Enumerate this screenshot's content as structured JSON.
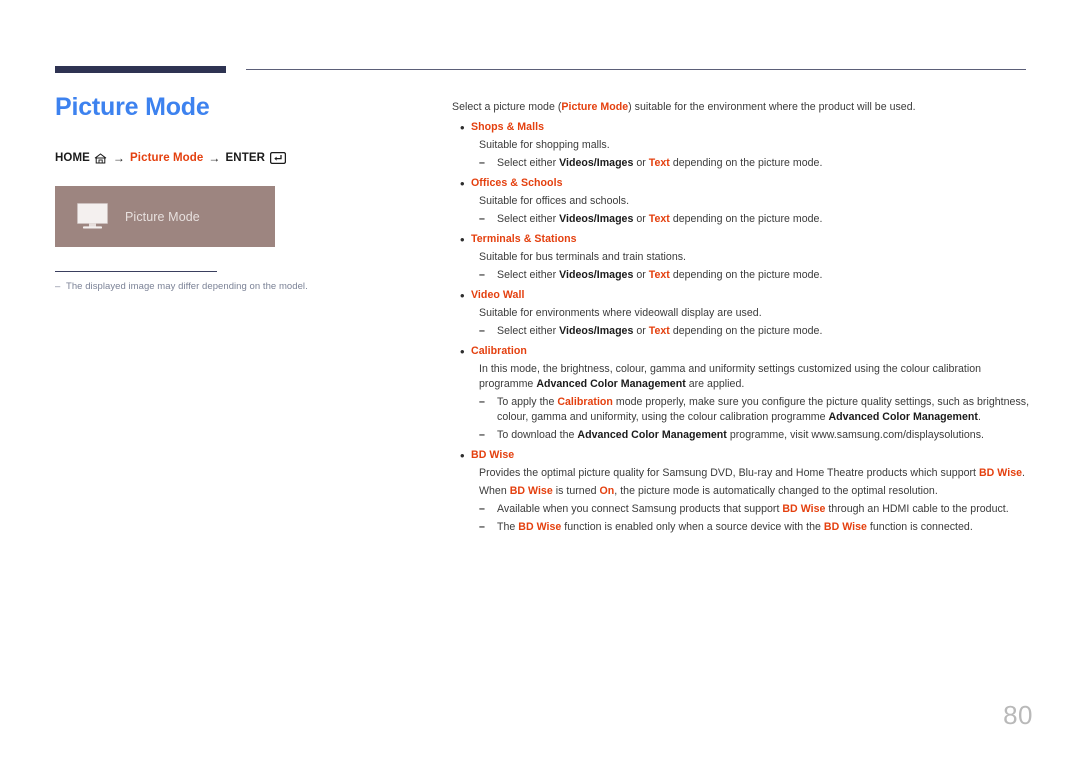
{
  "page": {
    "title": "Picture Mode",
    "number": "80"
  },
  "breadcrumb": {
    "home_label": "HOME",
    "home_icon": "home-icon",
    "arrow": "→",
    "middle_label": "Picture Mode",
    "enter_label": "ENTER",
    "enter_icon": "enter-key-icon"
  },
  "preview": {
    "icon": "monitor-icon",
    "label": "Picture Mode"
  },
  "note": {
    "dash": "–",
    "text": "The displayed image may differ depending on the model."
  },
  "content": {
    "intro": {
      "pre": "Select a picture mode (",
      "bold": "Picture Mode",
      "post": ") suitable for the environment where the product will be used."
    },
    "bullet_char": "•",
    "dash_char": "–",
    "common_dash": {
      "pre": "Select either ",
      "b1": "Videos/Images",
      "mid": " or ",
      "b2": "Text",
      "post": " depending on the picture mode."
    },
    "items": [
      {
        "title": "Shops & Malls",
        "desc": "Suitable for shopping malls."
      },
      {
        "title": "Offices & Schools",
        "desc": "Suitable for offices and schools."
      },
      {
        "title": "Terminals & Stations",
        "desc": "Suitable for bus terminals and train stations."
      },
      {
        "title": "Video Wall",
        "desc": "Suitable for environments where videowall display are used."
      }
    ],
    "calibration": {
      "title": "Calibration",
      "desc_pre": "In this mode, the brightness, colour, gamma and uniformity settings customized using the colour calibration programme ",
      "desc_bold": "Advanced Color Management",
      "desc_post": " are applied.",
      "dash1_pre": "To apply the ",
      "dash1_red": "Calibration",
      "dash1_mid": " mode properly, make sure you configure the picture quality settings, such as brightness, colour, gamma and uniformity, using the colour calibration programme ",
      "dash1_bold": "Advanced Color Management",
      "dash1_post": ".",
      "dash2_pre": "To download the ",
      "dash2_bold": "Advanced Color Management",
      "dash2_post": " programme, visit www.samsung.com/displaysolutions."
    },
    "bdwise": {
      "title": "BD Wise",
      "p1_pre": "Provides the optimal picture quality for Samsung DVD, Blu-ray and Home Theatre products which support ",
      "p1_red": "BD Wise",
      "p1_post": ".",
      "p2_pre": "When ",
      "p2_red1": "BD Wise",
      "p2_mid1": " is turned ",
      "p2_red2": "On",
      "p2_post": ", the picture mode is automatically changed to the optimal resolution.",
      "dash1_pre": "Available when you connect Samsung products that support ",
      "dash1_red": "BD Wise",
      "dash1_post": " through an HDMI cable to the product.",
      "dash2_pre": "The ",
      "dash2_red1": "BD Wise",
      "dash2_mid": " function is enabled only when a source device with the ",
      "dash2_red2": "BD Wise",
      "dash2_post": " function is connected."
    }
  },
  "colors": {
    "title_blue": "#3d82ef",
    "accent_red": "#e4400f",
    "navy": "#2e3352",
    "mauve": "#9d8580",
    "note_gray": "#7b8296"
  }
}
